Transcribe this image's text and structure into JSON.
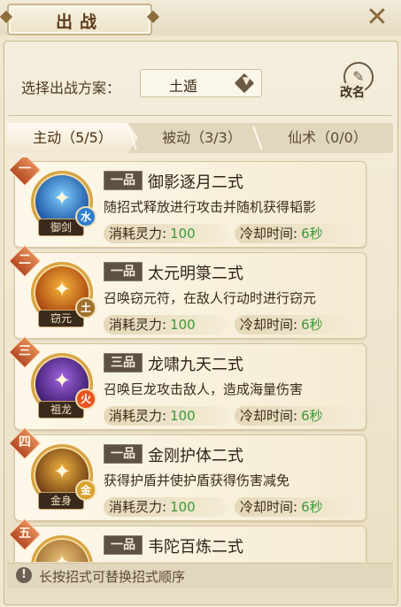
{
  "window": {
    "title": "出战",
    "close_symbol": "✕"
  },
  "plan": {
    "label": "选择出战方案：",
    "selected": "土遁",
    "rename_label": "改名"
  },
  "tabs": [
    {
      "label": "主动（5/5）",
      "active": true
    },
    {
      "label": "被动（3/3）",
      "active": false
    },
    {
      "label": "仙术（0/0）",
      "active": false
    }
  ],
  "stat_labels": {
    "cost": "消耗灵力:",
    "cooldown": "冷却时间:"
  },
  "skills": [
    {
      "rank": "一",
      "grade": "一品",
      "name": "御影逐月二式",
      "desc": "随招式释放进行攻击并随机获得韬影",
      "cost": "100",
      "cooldown": "6秒",
      "icon_name": "御剑",
      "element": "水",
      "element_color": "#2f7fd1",
      "icon_colors": [
        "#1a4fa0",
        "#7fd0ff"
      ]
    },
    {
      "rank": "二",
      "grade": "一品",
      "name": "太元明箓二式",
      "desc": "召唤窃元符，在敌人行动时进行窃元",
      "cost": "100",
      "cooldown": "6秒",
      "icon_name": "窃元",
      "element": "土",
      "element_color": "#a0702d",
      "icon_colors": [
        "#a6410f",
        "#f5b53a"
      ]
    },
    {
      "rank": "三",
      "grade": "三品",
      "name": "龙啸九天二式",
      "desc": "召唤巨龙攻击敌人，造成海量伤害",
      "cost": "100",
      "cooldown": "6秒",
      "icon_name": "祖龙",
      "element": "火",
      "element_color": "#e8541f",
      "icon_colors": [
        "#3b1a6b",
        "#a065e0"
      ]
    },
    {
      "rank": "四",
      "grade": "一品",
      "name": "金刚护体二式",
      "desc": "获得护盾并使护盾获得伤害减免",
      "cost": "100",
      "cooldown": "6秒",
      "icon_name": "金身",
      "element": "金",
      "element_color": "#d8a12b",
      "icon_colors": [
        "#6b3a12",
        "#f0b340"
      ]
    },
    {
      "rank": "五",
      "grade": "一品",
      "name": "韦陀百炼二式",
      "desc": "",
      "cost": "",
      "cooldown": "",
      "icon_name": "",
      "element": "",
      "element_color": "#d8a12b",
      "icon_colors": [
        "#9c6a2a",
        "#e8c27a"
      ]
    }
  ],
  "footer": {
    "icon": "!",
    "hint": "长按招式可替换招式顺序"
  },
  "colors": {
    "accent_green": "#3a9a38",
    "badge_orange": "#c6592c"
  }
}
